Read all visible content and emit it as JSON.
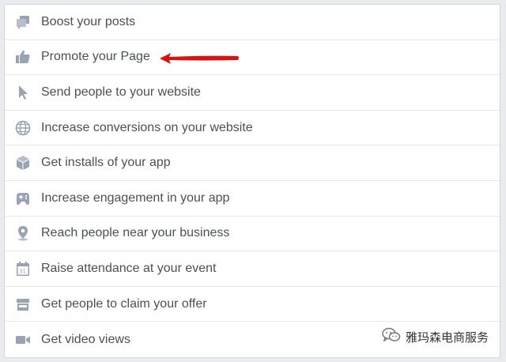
{
  "objectives": [
    {
      "label": "Boost your posts",
      "icon": "boost-posts-icon"
    },
    {
      "label": "Promote your Page",
      "icon": "thumbs-up-icon"
    },
    {
      "label": "Send people to your website",
      "icon": "cursor-icon"
    },
    {
      "label": "Increase conversions on your website",
      "icon": "globe-icon"
    },
    {
      "label": "Get installs of your app",
      "icon": "box-icon"
    },
    {
      "label": "Increase engagement in your app",
      "icon": "gamepad-icon"
    },
    {
      "label": "Reach people near your business",
      "icon": "map-pin-icon"
    },
    {
      "label": "Raise attendance at your event",
      "icon": "calendar-icon"
    },
    {
      "label": "Get people to claim your offer",
      "icon": "store-icon"
    },
    {
      "label": "Get video views",
      "icon": "video-camera-icon"
    }
  ],
  "annotation": {
    "color": "#d61414",
    "points_to": "Promote your Page"
  },
  "watermark": {
    "text": "雅玛森电商服务"
  },
  "colors": {
    "icon": "#9aa3b3",
    "text": "#4b4f56",
    "divider": "#e5e7eb"
  }
}
